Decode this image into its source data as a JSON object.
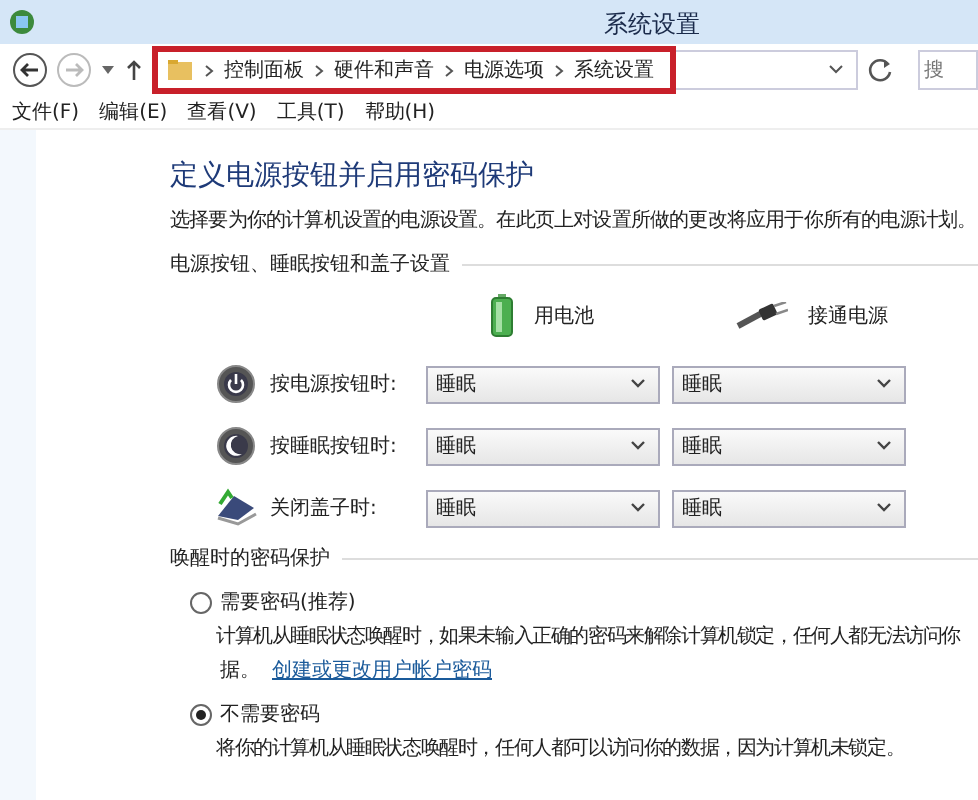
{
  "window": {
    "title": "系统设置"
  },
  "address_bar": {
    "breadcrumbs": [
      "控制面板",
      "硬件和声音",
      "电源选项",
      "系统设置"
    ],
    "highlighted": true,
    "search": {
      "placeholder": "搜"
    }
  },
  "menu": [
    "文件(F)",
    "编辑(E)",
    "查看(V)",
    "工具(T)",
    "帮助(H)"
  ],
  "heading": "定义电源按钮并启用密码保护",
  "subtitle": "选择要为你的计算机设置的电源设置。在此页上对设置所做的更改将应用于你所有的电源计划。",
  "button_settings": {
    "title": "电源按钮、睡眠按钮和盖子设置",
    "columns": [
      {
        "kind": "battery",
        "label": "用电池"
      },
      {
        "kind": "plug",
        "label": "接通电源"
      }
    ],
    "rows": [
      {
        "kind": "power",
        "label": "按电源按钮时:",
        "values": [
          "睡眠",
          "睡眠"
        ]
      },
      {
        "kind": "sleep",
        "label": "按睡眠按钮时:",
        "values": [
          "睡眠",
          "睡眠"
        ]
      },
      {
        "kind": "lid",
        "label": "关闭盖子时:",
        "values": [
          "睡眠",
          "睡眠"
        ]
      }
    ]
  },
  "password_protection": {
    "title": "唤醒时的密码保护",
    "options": [
      {
        "label": "需要密码(推荐)",
        "selected": false,
        "description": "计算机从睡眠状态唤醒时，如果未输入正确的密码来解除计算机锁定，任何人都无法访问你",
        "continuation": "据。",
        "link": "创建或更改用户帐户密码"
      },
      {
        "label": "不需要密码",
        "selected": true,
        "description": "将你的计算机从睡眠状态唤醒时，任何人都可以访问你的数据，因为计算机未锁定。"
      }
    ]
  }
}
